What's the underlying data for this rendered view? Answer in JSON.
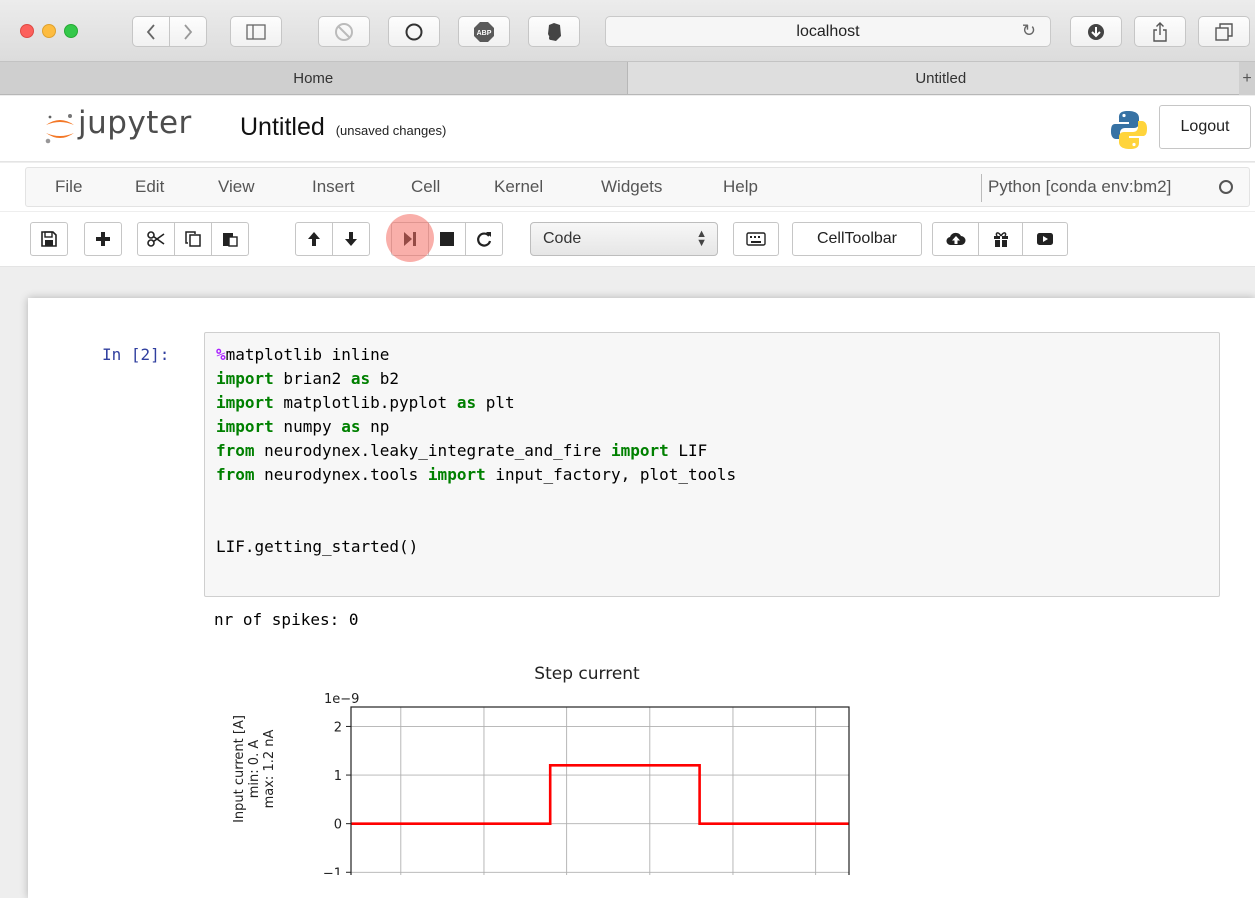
{
  "browser": {
    "address": "localhost",
    "tabs": [
      "Home",
      "Untitled"
    ],
    "plus": "+"
  },
  "jupyter": {
    "logo_text": "jupyter",
    "notebook_title": "Untitled",
    "save_status": "(unsaved changes)",
    "logout_label": "Logout"
  },
  "menu": {
    "items": [
      "File",
      "Edit",
      "View",
      "Insert",
      "Cell",
      "Kernel",
      "Widgets",
      "Help"
    ],
    "kernel": "Python [conda env:bm2]"
  },
  "toolbar": {
    "cell_type": "Code",
    "celltoolbar_label": "CellToolbar",
    "icons": [
      "save-icon",
      "add-icon",
      "cut-icon",
      "copy-icon",
      "paste-icon",
      "move-up-icon",
      "move-down-icon",
      "run-icon",
      "stop-icon",
      "restart-icon",
      "keyboard-icon",
      "cloud-upload-icon",
      "gift-icon",
      "video-icon"
    ]
  },
  "cell": {
    "prompt": "In [2]:",
    "code": [
      [
        {
          "t": "%",
          "c": "mg"
        },
        {
          "t": "matplotlib inline",
          "c": ""
        }
      ],
      [
        {
          "t": "import",
          "c": "kw"
        },
        {
          "t": " brian2 ",
          "c": ""
        },
        {
          "t": "as",
          "c": "kw"
        },
        {
          "t": " b2",
          "c": ""
        }
      ],
      [
        {
          "t": "import",
          "c": "kw"
        },
        {
          "t": " matplotlib.pyplot ",
          "c": ""
        },
        {
          "t": "as",
          "c": "kw"
        },
        {
          "t": " plt",
          "c": ""
        }
      ],
      [
        {
          "t": "import",
          "c": "kw"
        },
        {
          "t": " numpy ",
          "c": ""
        },
        {
          "t": "as",
          "c": "kw"
        },
        {
          "t": " np",
          "c": ""
        }
      ],
      [
        {
          "t": "from",
          "c": "kw"
        },
        {
          "t": " neurodynex.leaky_integrate_and_fire ",
          "c": ""
        },
        {
          "t": "import",
          "c": "kw"
        },
        {
          "t": " LIF",
          "c": ""
        }
      ],
      [
        {
          "t": "from",
          "c": "kw"
        },
        {
          "t": " neurodynex.tools ",
          "c": ""
        },
        {
          "t": "import",
          "c": "kw"
        },
        {
          "t": " input_factory, plot_tools",
          "c": ""
        }
      ],
      [],
      [],
      [
        {
          "t": "LIF.getting_started()",
          "c": ""
        }
      ]
    ],
    "output_text": "nr of spikes: 0"
  },
  "chart_data": {
    "type": "line",
    "title": "Step current",
    "offset_label": "1e−9",
    "ylabel_lines": [
      "Input current [A]",
      "min: 0. A",
      "max: 1.2 nA"
    ],
    "yticks": [
      2,
      1,
      0,
      -1
    ],
    "ylim": [
      -1.2,
      2.4
    ],
    "xlim": [
      0,
      1
    ],
    "x": [
      0,
      0.1,
      0.4,
      0.4,
      0.7,
      0.7,
      1.0
    ],
    "y": [
      0,
      0,
      0,
      1.2,
      1.2,
      0,
      0
    ],
    "color": "#ff0000",
    "grid": true
  }
}
